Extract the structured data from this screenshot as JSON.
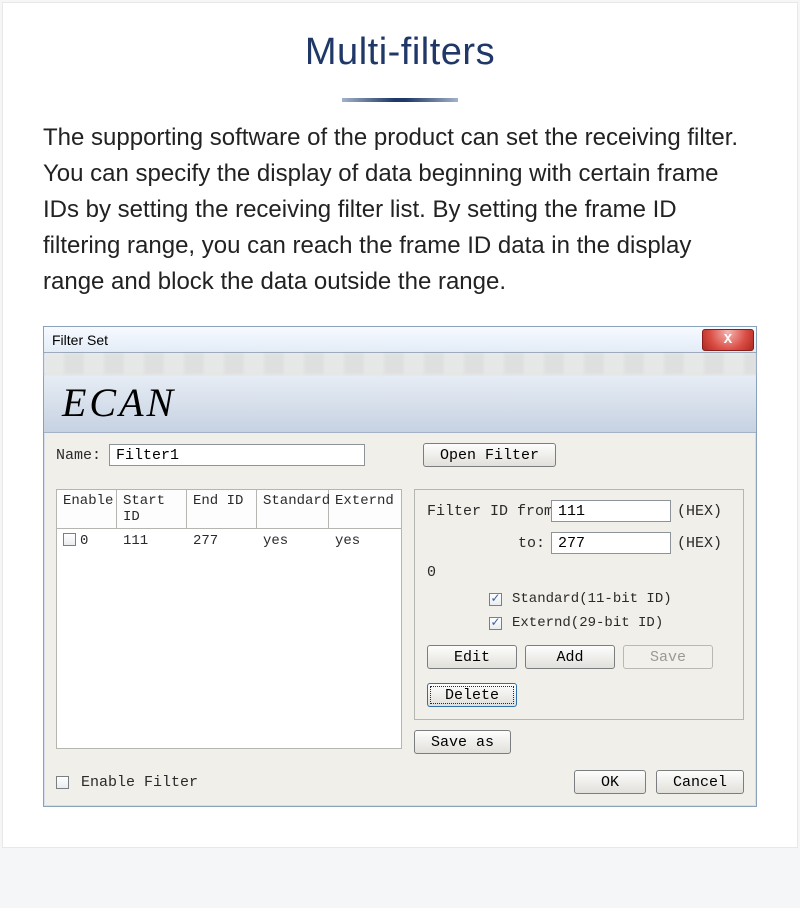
{
  "header": {
    "title": "Multi-filters",
    "description": "The supporting software of the product can set the receiving filter. You can specify the display of data beginning with certain frame IDs by setting the receiving filter list. By setting the frame ID filtering range, you can reach the frame ID data in the display range and block the data outside the range."
  },
  "dialog": {
    "title": "Filter Set",
    "brand": "ECAN",
    "name_label": "Name:",
    "name_value": "Filter1",
    "open_filter": "Open Filter",
    "table": {
      "headers": [
        "Enable",
        "Start ID",
        "End ID",
        "Standard",
        "Externd"
      ],
      "rows": [
        {
          "enable_checked": false,
          "index": "0",
          "start": "111",
          "end": "277",
          "standard": "yes",
          "externd": "yes"
        }
      ]
    },
    "props": {
      "from_label": "Filter ID from:",
      "from_value": "111",
      "to_label": "to:",
      "to_value": "277",
      "hex": "(HEX)",
      "zero": "0",
      "standard_cb_checked": true,
      "standard_cb_label": "Standard(11-bit ID)",
      "externd_cb_checked": true,
      "externd_cb_label": "Externd(29-bit ID)",
      "edit": "Edit",
      "add": "Add",
      "save": "Save",
      "delete": "Delete",
      "save_as": "Save as"
    },
    "footer": {
      "enable_filter_checked": false,
      "enable_filter_label": "Enable Filter",
      "ok": "OK",
      "cancel": "Cancel"
    }
  }
}
